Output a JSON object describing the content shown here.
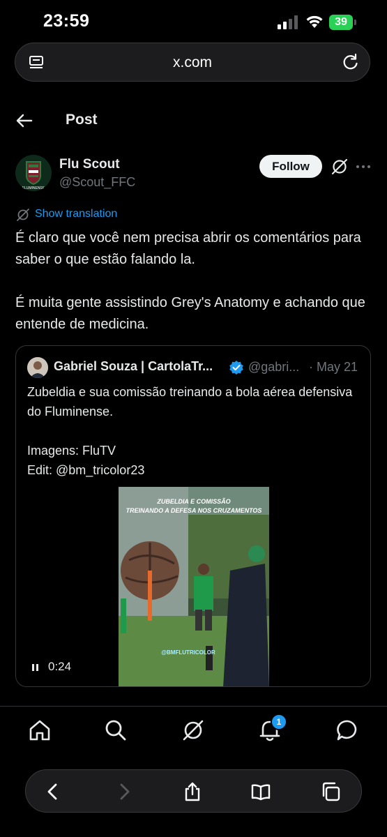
{
  "status_bar": {
    "time": "23:59",
    "battery": "39"
  },
  "browser": {
    "url": "x.com"
  },
  "header": {
    "title": "Post"
  },
  "post": {
    "author_name": "Flu Scout",
    "author_handle": "@Scout_FFC",
    "follow_label": "Follow",
    "show_translation": "Show translation",
    "paragraphs": [
      "É claro que você nem precisa abrir os comentários para saber o que estão falando la.",
      "É muita gente assistindo Grey's Anatomy e achando que entende de medicina."
    ]
  },
  "quoted": {
    "author_name": "Gabriel Souza | CartolaTr...",
    "handle": "@gabri...",
    "date": "· May 21",
    "paragraphs": [
      "Zubeldia e sua comissão treinando a bola aérea defensiva do Fluminense.",
      "Imagens: FluTV\nEdit: @bm_tricolor23"
    ],
    "video": {
      "duration": "0:24",
      "overlay_line1": "ZUBELDIA E COMISSÃO",
      "overlay_line2": "TREINANDO A DEFESA NOS CRUZAMENTOS",
      "watermark": "@BMFLUTRICOLOR"
    }
  },
  "bottom_nav": {
    "notifications_badge": "1"
  },
  "colors": {
    "accent": "#1d9bf0",
    "battery": "#2bd157",
    "muted": "#71767b"
  }
}
